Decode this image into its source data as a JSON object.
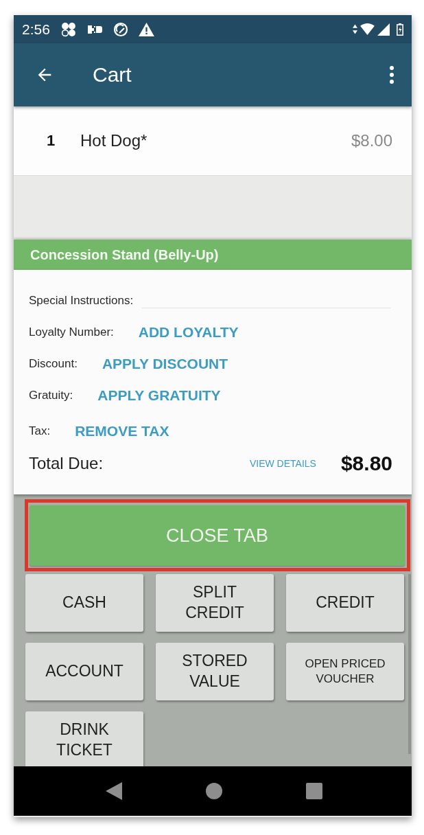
{
  "status_bar": {
    "time": "2:56"
  },
  "app_bar": {
    "title": "Cart"
  },
  "cart_items": [
    {
      "quantity": "1",
      "name": "Hot Dog*",
      "price": "$8.00"
    }
  ],
  "order": {
    "header": "Concession Stand (Belly-Up)",
    "fields": [
      {
        "kind": "input",
        "label": "Special Instructions:"
      },
      {
        "kind": "action",
        "label": "Loyalty Number:",
        "action": "ADD LOYALTY"
      },
      {
        "kind": "action",
        "label": "Discount:",
        "action": "APPLY DISCOUNT"
      },
      {
        "kind": "action",
        "label": "Gratuity:",
        "action": "APPLY GRATUITY"
      },
      {
        "kind": "action",
        "label": "Tax:",
        "action": "REMOVE TAX"
      }
    ],
    "total": {
      "label": "Total Due:",
      "link": "VIEW DETAILS",
      "amount": "$8.80"
    }
  },
  "close_tab": {
    "label": "CLOSE TAB",
    "highlighted": true
  },
  "payment_buttons": [
    {
      "label": "CASH"
    },
    {
      "label": "SPLIT CREDIT"
    },
    {
      "label": "CREDIT"
    },
    {
      "label": "ACCOUNT"
    },
    {
      "label": "STORED VALUE"
    },
    {
      "label": "OPEN PRICED VOUCHER"
    },
    {
      "label": "DRINK TICKET"
    }
  ]
}
